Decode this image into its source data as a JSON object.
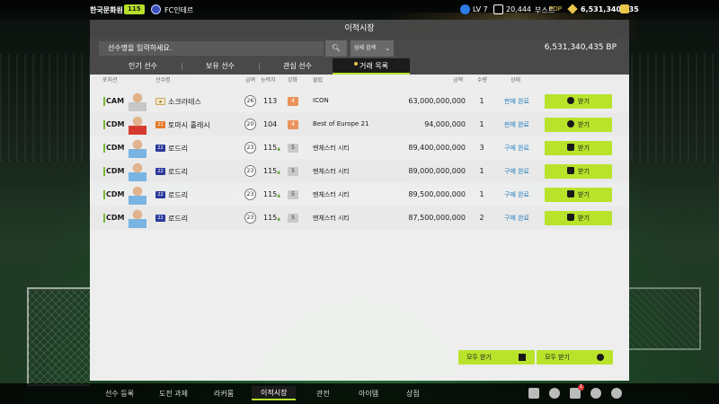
{
  "topbar": {
    "team_name": "한국문화원",
    "team_badge": "115",
    "club_name": "FC인테르",
    "level": "LV 7",
    "fc_points": "20,444",
    "boost_label": "부스트",
    "top_label": "TOP",
    "bp": "6,531,340,435"
  },
  "panel": {
    "title": "이적시장",
    "search_placeholder": "선수명을 입력하세요.",
    "detail_search_label": "상세 검색",
    "bp_total": "6,531,340,435 BP"
  },
  "tabs": [
    {
      "label": "인기 선수"
    },
    {
      "label": "보유 선수"
    },
    {
      "label": "관심 선수"
    },
    {
      "label": "거래 목록"
    }
  ],
  "table": {
    "headers": {
      "position": "포지션",
      "player": "선수명",
      "pay": "급여",
      "ability": "능력치",
      "enhance": "강화",
      "club": "클럽",
      "price": "금액",
      "qty": "수량",
      "status": "상태"
    },
    "rows": [
      {
        "position": "CAM",
        "season": "",
        "name": "소크라테스",
        "pay": "26",
        "ability": "113",
        "enhance": "4",
        "club": "ICON",
        "price": "63,000,000,000",
        "qty": "1",
        "status": "판매 완료",
        "receive": "받기",
        "receive_icon": "coin-icon"
      },
      {
        "position": "CDM",
        "season": "",
        "name": "토마시 홀레시",
        "pay": "20",
        "ability": "104",
        "enhance": "4",
        "club": "Best of Europe 21",
        "price": "94,000,000",
        "qty": "1",
        "status": "판매 완료",
        "receive": "받기",
        "receive_icon": "coin-icon"
      },
      {
        "position": "CDM",
        "season": "22",
        "name": "로드리",
        "pay": "23",
        "ability": "115",
        "enhance": "5",
        "club": "맨체스터 시티",
        "price": "89,400,000,000",
        "qty": "3",
        "status": "구매 완료",
        "receive": "받기",
        "receive_icon": "shirt-icon"
      },
      {
        "position": "CDM",
        "season": "22",
        "name": "로드리",
        "pay": "23",
        "ability": "115",
        "enhance": "5",
        "club": "맨체스터 시티",
        "price": "89,000,000,000",
        "qty": "1",
        "status": "구매 완료",
        "receive": "받기",
        "receive_icon": "shirt-icon"
      },
      {
        "position": "CDM",
        "season": "22",
        "name": "로드리",
        "pay": "23",
        "ability": "115",
        "enhance": "5",
        "club": "맨체스터 시티",
        "price": "89,500,000,000",
        "qty": "1",
        "status": "구매 완료",
        "receive": "받기",
        "receive_icon": "shirt-icon"
      },
      {
        "position": "CDM",
        "season": "22",
        "name": "로드리",
        "pay": "23",
        "ability": "115",
        "enhance": "5",
        "club": "맨체스터 시티",
        "price": "87,500,000,000",
        "qty": "2",
        "status": "구매 완료",
        "receive": "받기",
        "receive_icon": "shirt-icon"
      }
    ]
  },
  "footer": {
    "receive_all_players": "모두 받기",
    "receive_all_bp": "모두 받기"
  },
  "bottomnav": {
    "items": [
      {
        "label": "선수 등록"
      },
      {
        "label": "도전 과제"
      },
      {
        "label": "라커룸"
      },
      {
        "label": "이적시장"
      },
      {
        "label": "관전"
      },
      {
        "label": "아이템"
      },
      {
        "label": "상점"
      }
    ],
    "notif_count": "1"
  },
  "colors": {
    "accent": "#b9e32b",
    "status_blue": "#2a7fbf",
    "panel_bg": "#f4f4f4"
  }
}
